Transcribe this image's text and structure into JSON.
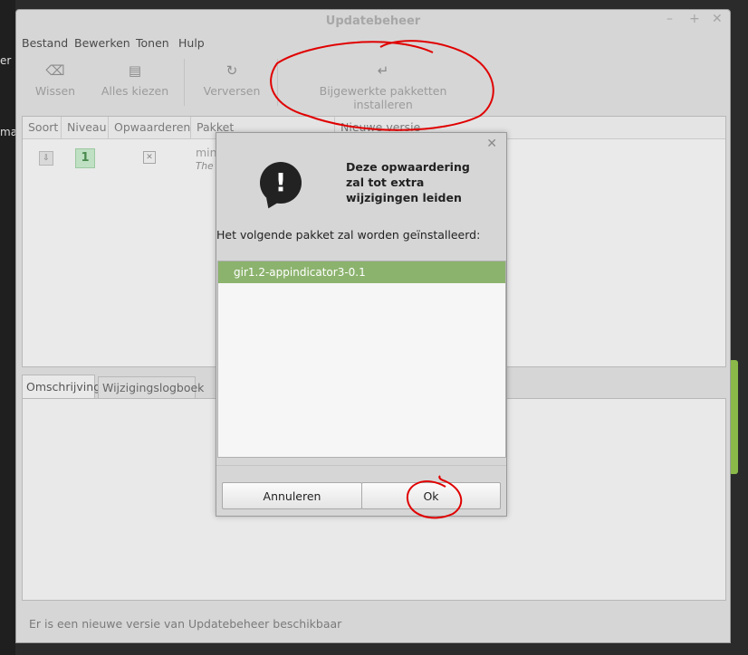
{
  "window": {
    "title": "Updatebeheer",
    "controls": [
      "–",
      "+",
      "✕"
    ]
  },
  "background": {
    "fragments": [
      "er",
      "ma"
    ]
  },
  "menubar": [
    "Bestand",
    "Bewerken",
    "Tonen",
    "Hulp"
  ],
  "toolbar": [
    {
      "icon": "clear-icon",
      "glyph": "⌫",
      "label": "Wissen"
    },
    {
      "icon": "select-all-icon",
      "glyph": "▤",
      "label": "Alles kiezen"
    },
    {
      "icon": "refresh-icon",
      "glyph": "↻",
      "label": "Verversen"
    },
    {
      "icon": "install-icon",
      "glyph": "↵",
      "label": "Bijgewerkte pakketten installeren"
    }
  ],
  "package_list": {
    "columns": [
      "Soort",
      "Niveau",
      "Opwaarderen",
      "Pakket",
      "Nieuwe versie"
    ],
    "rows": [
      {
        "level": "1",
        "package_name": "mint",
        "package_desc": "The L"
      }
    ]
  },
  "tabs": [
    "Omschrijving",
    "Wijzigingslogboek"
  ],
  "status": "Er is een nieuwe versie van Updatebeheer beschikbaar",
  "dialog": {
    "heading": "Deze opwaardering zal tot extra wijzigingen leiden",
    "message": "Het volgende pakket zal worden geïnstalleerd:",
    "packages": [
      "gir1.2-appindicator3-0.1"
    ],
    "cancel_label": "Annuleren",
    "ok_label": "Ok",
    "close_glyph": "✕",
    "icon_glyph": "!"
  },
  "colors": {
    "selection": "#8cb36e",
    "annotation": "#e00000",
    "level_badge": "#bfe0c3"
  }
}
